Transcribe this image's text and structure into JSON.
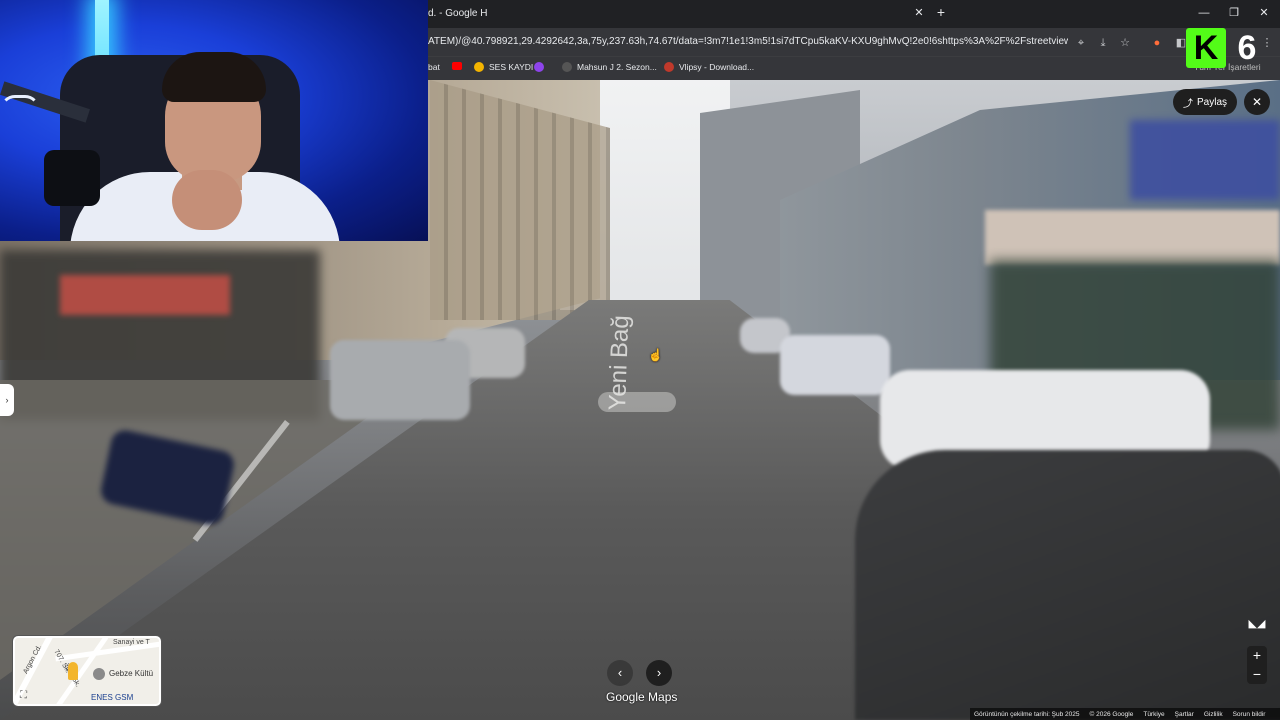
{
  "browser": {
    "tab_title": "d. - Google H",
    "tab_close": "✕",
    "tab_new": "+",
    "window_controls": [
      "—",
      "❐",
      "✕"
    ],
    "url": "ATEM)/@40.798921,29.4292642,3a,75y,237.63h,74.67t/data=!3m7!1e1!3m5!1si7dTCpu5kaKV-KXU9ghMvQ!2e0!6shttps%3A%2F%2Fstreetviewpixels-pa.google..."
  },
  "bookmarks": [
    {
      "label": "bat",
      "color": "#9aa0a6"
    },
    {
      "label": "",
      "color": "#ff0000"
    },
    {
      "label": "SES KAYDI",
      "color": "#f4b400"
    },
    {
      "label": "",
      "color": "#8e44ec"
    },
    {
      "label": "Mahsun J 2. Sezon...",
      "color": "#2b2b2b"
    },
    {
      "label": "Vlipsy - Download...",
      "color": "#c0392b"
    }
  ],
  "bookmarks_right": "Tüm Yer İşaretleri",
  "channel_badge": {
    "letter": "K",
    "number": "6",
    "accent": "#53fc18"
  },
  "street_view": {
    "road_label": "Yeni Bağ",
    "share_label": "Paylaş",
    "close_icon": "✕",
    "expand_icon": "›",
    "nav_prev": "‹",
    "nav_next": "›",
    "logo": "Google Maps",
    "zoom_in": "+",
    "zoom_out": "−"
  },
  "minimap": {
    "labels": {
      "street1": "Sanayi ve T",
      "street2": "707. Sk.",
      "street3": "710. Sk.",
      "street4": "Argon Cd.",
      "poi1": "Gebze Kültü",
      "poi2": "ENES GSM"
    }
  },
  "footer": [
    "Görüntünün çekilme tarihi: Şub 2025",
    "© 2026 Google",
    "Türkiye",
    "Şartlar",
    "Gizlilik",
    "Sorun bildir"
  ]
}
